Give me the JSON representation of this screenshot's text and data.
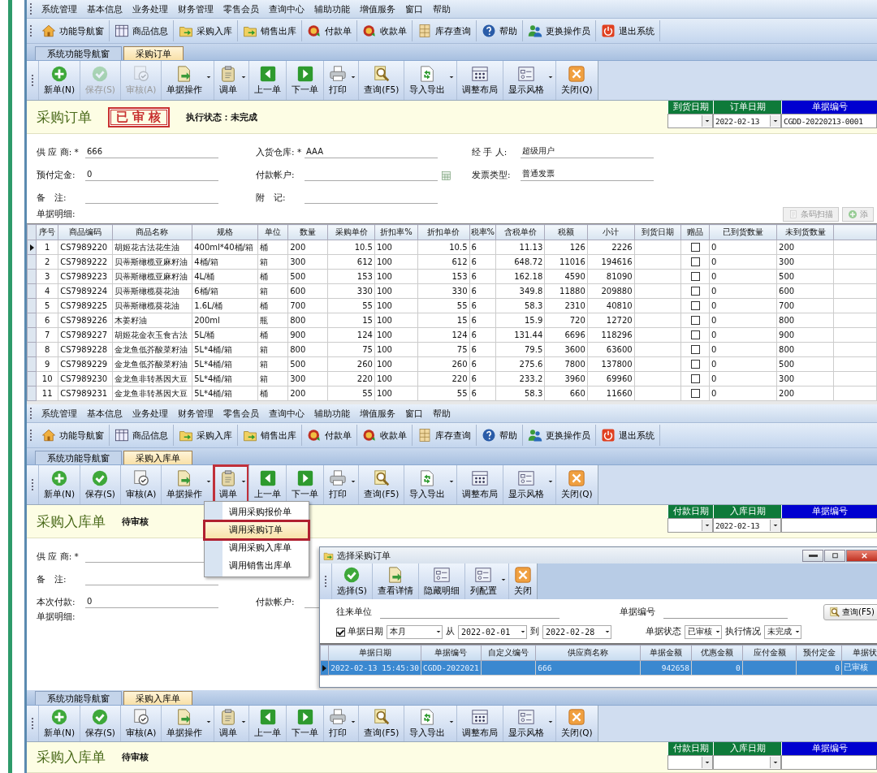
{
  "screens": [
    {
      "menu": [
        "系统管理",
        "基本信息",
        "业务处理",
        "财务管理",
        "零售会员",
        "查询中心",
        "辅助功能",
        "增值服务",
        "窗口",
        "帮助"
      ],
      "quickbar": [
        {
          "label": "功能导航窗",
          "kind": "home"
        },
        {
          "label": "商品信息",
          "kind": "table"
        },
        {
          "label": "采购入库",
          "kind": "folder"
        },
        {
          "label": "销售出库",
          "kind": "folder"
        },
        {
          "label": "付款单",
          "kind": "coin"
        },
        {
          "label": "收款单",
          "kind": "coin"
        },
        {
          "label": "库存查询",
          "kind": "cabinet"
        },
        {
          "label": "帮助",
          "kind": "help"
        },
        {
          "label": "更换操作员",
          "kind": "people"
        },
        {
          "label": "退出系统",
          "kind": "power"
        }
      ],
      "tabs": [
        {
          "label": "系统功能导航窗",
          "selected": false
        },
        {
          "label": "采购订单",
          "selected": true
        }
      ],
      "toolbar": [
        {
          "label": "新单(N)",
          "kind": "add",
          "disabled": false,
          "dropdown": false,
          "annotated": false
        },
        {
          "label": "保存(S)",
          "kind": "check",
          "disabled": true,
          "dropdown": false,
          "annotated": false
        },
        {
          "label": "审核(A)",
          "kind": "audit",
          "disabled": true,
          "dropdown": false,
          "annotated": false
        },
        {
          "label": "单据操作",
          "kind": "docarrow",
          "disabled": false,
          "dropdown": true,
          "annotated": false
        },
        {
          "label": "调单",
          "kind": "clipboard",
          "disabled": false,
          "dropdown": true,
          "annotated": false
        },
        {
          "label": "上一单",
          "kind": "prev",
          "disabled": false,
          "dropdown": false,
          "annotated": false
        },
        {
          "label": "下一单",
          "kind": "next",
          "disabled": false,
          "dropdown": false,
          "annotated": false
        },
        {
          "label": "打印",
          "kind": "printer",
          "disabled": false,
          "dropdown": true,
          "annotated": false
        },
        {
          "label": "查询(F5)",
          "kind": "search",
          "disabled": false,
          "dropdown": false,
          "annotated": false
        },
        {
          "label": "导入导出",
          "kind": "import",
          "disabled": false,
          "dropdown": true,
          "annotated": false
        },
        {
          "label": "调整布局",
          "kind": "grid",
          "disabled": false,
          "dropdown": false,
          "annotated": false
        },
        {
          "label": "显示风格",
          "kind": "layout",
          "disabled": false,
          "dropdown": true,
          "annotated": false
        },
        {
          "label": "关闭(Q)",
          "kind": "close",
          "disabled": false,
          "dropdown": false,
          "annotated": false
        }
      ],
      "header": {
        "title": "采购订单",
        "stamp": {
          "kind": "seal",
          "text": "已审核"
        },
        "status": "执行状态：未完成",
        "dates": [
          {
            "label": "到货日期",
            "color": "#0e7a3a",
            "dropdown": true
          },
          {
            "label": "订单日期",
            "color": "#0e7a3a",
            "value": "2022-02-13",
            "dropdown": true
          },
          {
            "label": "单据编号",
            "color": "#0000d0",
            "value": "CGDD-20220213-0001",
            "dropdown": false
          }
        ]
      },
      "form": [
        [
          {
            "label": "供 应 商: *",
            "value": "666"
          },
          {
            "label": "入货仓库: *",
            "value": "AAA"
          },
          {
            "label": "经 手 人:",
            "value": "超级用户"
          }
        ],
        [
          {
            "label": "预付定金:",
            "value": "0"
          },
          {
            "label": "付款帐户:",
            "lookup": true
          },
          {
            "label": "发票类型:",
            "value": "普通发票"
          }
        ],
        [
          {
            "label": "备　注:"
          },
          {
            "label": "附　记:"
          }
        ]
      ],
      "detail_label": "单据明细:",
      "detail_buttons": [
        {
          "label": "条码扫描",
          "kind": "doc",
          "disabled": true
        },
        {
          "label": "添",
          "kind": "plus",
          "disabled": true
        }
      ],
      "table": {
        "columns": [
          "序号",
          "商品编码",
          "商品名称",
          "规格",
          "单位",
          "数量",
          "采购单价",
          "折扣率%",
          "折扣单价",
          "税率%",
          "含税单价",
          "税额",
          "小计",
          "到货日期",
          "赠品",
          "已到货数量",
          "未到货数量"
        ],
        "rows": [
          {
            "selected": true,
            "cells": [
              "1",
              "CS7989220",
              "胡姬花古法花生油",
              "400ml*40桶/箱",
              "桶",
              "200",
              "10.5",
              "100",
              "10.5",
              "6",
              "11.13",
              "126",
              "2226",
              null,
              false,
              "0",
              "200"
            ]
          },
          {
            "selected": false,
            "cells": [
              "2",
              "CS7989222",
              "贝蒂斯橄榄亚麻籽油",
              "4桶/箱",
              "箱",
              "300",
              "612",
              "100",
              "612",
              "6",
              "648.72",
              "11016",
              "194616",
              null,
              false,
              "0",
              "300"
            ]
          },
          {
            "selected": false,
            "cells": [
              "3",
              "CS7989223",
              "贝蒂斯橄榄亚麻籽油",
              "4L/桶",
              "桶",
              "500",
              "153",
              "100",
              "153",
              "6",
              "162.18",
              "4590",
              "81090",
              null,
              false,
              "0",
              "500"
            ]
          },
          {
            "selected": false,
            "cells": [
              "4",
              "CS7989224",
              "贝蒂斯橄榄葵花油",
              "6桶/箱",
              "箱",
              "600",
              "330",
              "100",
              "330",
              "6",
              "349.8",
              "11880",
              "209880",
              null,
              false,
              "0",
              "600"
            ]
          },
          {
            "selected": false,
            "cells": [
              "5",
              "CS7989225",
              "贝蒂斯橄榄葵花油",
              "1.6L/桶",
              "桶",
              "700",
              "55",
              "100",
              "55",
              "6",
              "58.3",
              "2310",
              "40810",
              null,
              false,
              "0",
              "700"
            ]
          },
          {
            "selected": false,
            "cells": [
              "6",
              "CS7989226",
              "木姜籽油",
              "200ml",
              "瓶",
              "800",
              "15",
              "100",
              "15",
              "6",
              "15.9",
              "720",
              "12720",
              null,
              false,
              "0",
              "800"
            ]
          },
          {
            "selected": false,
            "cells": [
              "7",
              "CS7989227",
              "胡姬花金衣玉食古法",
              "5L/桶",
              "桶",
              "900",
              "124",
              "100",
              "124",
              "6",
              "131.44",
              "6696",
              "118296",
              null,
              false,
              "0",
              "900"
            ]
          },
          {
            "selected": false,
            "cells": [
              "8",
              "CS7989228",
              "金龙鱼低芥酸菜籽油",
              "5L*4桶/箱",
              "箱",
              "800",
              "75",
              "100",
              "75",
              "6",
              "79.5",
              "3600",
              "63600",
              null,
              false,
              "0",
              "800"
            ]
          },
          {
            "selected": false,
            "cells": [
              "9",
              "CS7989229",
              "金龙鱼低芥酸菜籽油",
              "5L*4桶/箱",
              "箱",
              "500",
              "260",
              "100",
              "260",
              "6",
              "275.6",
              "7800",
              "137800",
              null,
              false,
              "0",
              "500"
            ]
          },
          {
            "selected": false,
            "cells": [
              "10",
              "CS7989230",
              "金龙鱼非转基因大豆",
              "5L*4桶/箱",
              "箱",
              "300",
              "220",
              "100",
              "220",
              "6",
              "233.2",
              "3960",
              "69960",
              null,
              false,
              "0",
              "300"
            ]
          },
          {
            "selected": false,
            "cells": [
              "11",
              "CS7989231",
              "金龙鱼非转基因大豆",
              "5L*4桶/箱",
              "桶",
              "200",
              "55",
              "100",
              "55",
              "6",
              "58.3",
              "660",
              "11660",
              null,
              false,
              "0",
              "200"
            ]
          }
        ]
      }
    },
    {
      "menu": [
        "系统管理",
        "基本信息",
        "业务处理",
        "财务管理",
        "零售会员",
        "查询中心",
        "辅助功能",
        "增值服务",
        "窗口",
        "帮助"
      ],
      "quickbar": [
        {
          "label": "功能导航窗",
          "kind": "home"
        },
        {
          "label": "商品信息",
          "kind": "table"
        },
        {
          "label": "采购入库",
          "kind": "folder"
        },
        {
          "label": "销售出库",
          "kind": "folder"
        },
        {
          "label": "付款单",
          "kind": "coin"
        },
        {
          "label": "收款单",
          "kind": "coin"
        },
        {
          "label": "库存查询",
          "kind": "cabinet"
        },
        {
          "label": "帮助",
          "kind": "help"
        },
        {
          "label": "更换操作员",
          "kind": "people"
        },
        {
          "label": "退出系统",
          "kind": "power"
        }
      ],
      "tabs": [
        {
          "label": "系统功能导航窗",
          "selected": false
        },
        {
          "label": "采购入库单",
          "selected": true
        }
      ],
      "toolbar": [
        {
          "label": "新单(N)",
          "kind": "add",
          "disabled": false,
          "dropdown": false,
          "annotated": false
        },
        {
          "label": "保存(S)",
          "kind": "check",
          "disabled": false,
          "dropdown": false,
          "annotated": false
        },
        {
          "label": "审核(A)",
          "kind": "audit",
          "disabled": false,
          "dropdown": false,
          "annotated": false
        },
        {
          "label": "单据操作",
          "kind": "docarrow",
          "disabled": false,
          "dropdown": true,
          "annotated": false
        },
        {
          "label": "调单",
          "kind": "clipboard",
          "disabled": false,
          "dropdown": true,
          "annotated": true
        },
        {
          "label": "上一单",
          "kind": "prev",
          "disabled": false,
          "dropdown": false,
          "annotated": false
        },
        {
          "label": "下一单",
          "kind": "next",
          "disabled": false,
          "dropdown": false,
          "annotated": false
        },
        {
          "label": "打印",
          "kind": "printer",
          "disabled": false,
          "dropdown": true,
          "annotated": false
        },
        {
          "label": "查询(F5)",
          "kind": "search",
          "disabled": false,
          "dropdown": false,
          "annotated": false
        },
        {
          "label": "导入导出",
          "kind": "import",
          "disabled": false,
          "dropdown": true,
          "annotated": false
        },
        {
          "label": "调整布局",
          "kind": "grid",
          "disabled": false,
          "dropdown": false,
          "annotated": false
        },
        {
          "label": "显示风格",
          "kind": "layout",
          "disabled": false,
          "dropdown": true,
          "annotated": false
        },
        {
          "label": "关闭(Q)",
          "kind": "close",
          "disabled": false,
          "dropdown": false,
          "annotated": false
        }
      ],
      "header": {
        "title": "采购入库单",
        "stamp": {
          "kind": "plain",
          "text": "待审核"
        },
        "dates": [
          {
            "label": "付款日期",
            "color": "#0e7a3a",
            "dropdown": true
          },
          {
            "label": "入库日期",
            "color": "#0e7a3a",
            "value": "2022-02-13",
            "dropdown": true
          },
          {
            "label": "单据编号",
            "color": "#0000d0",
            "dropdown": false
          }
        ]
      },
      "form": [
        [
          {
            "label": "供 应 商: *"
          }
        ],
        [
          {
            "label": "备　注:"
          }
        ],
        [
          {
            "label": "本次付款:",
            "value": "0"
          },
          {
            "label": "付款帐户:"
          }
        ]
      ],
      "detail_label": "单据明细:",
      "dropdown_menu": [
        {
          "label": "调用采购报价单",
          "selected": false,
          "annotated": false
        },
        {
          "label": "调用采购订单",
          "selected": true,
          "annotated": true
        },
        {
          "label": "调用采购入库单",
          "selected": false,
          "annotated": false
        },
        {
          "label": "调用销售出库单",
          "selected": false,
          "annotated": false
        }
      ],
      "dialog": {
        "title": "选择采购订单",
        "toolbar": [
          {
            "label": "选择(S)",
            "kind": "check",
            "dropdown": false
          },
          {
            "label": "查看详情",
            "kind": "docarrow",
            "dropdown": false
          },
          {
            "label": "隐藏明细",
            "kind": "layout",
            "dropdown": false
          },
          {
            "label": "列配置",
            "kind": "layout",
            "dropdown": true
          },
          {
            "label": "关闭",
            "kind": "close",
            "dropdown": false
          }
        ],
        "filters": {
          "partner_label": "往来单位",
          "number_label": "单据编号",
          "query_button": "查询(F5)",
          "date_check": {
            "label": "单据日期",
            "checked": true
          },
          "period": "本月",
          "from_label": "从",
          "from": "2022-02-01",
          "to_label": "到",
          "to": "2022-02-28",
          "status_label": "单据状态",
          "status": "已审核",
          "exec_label": "执行情况",
          "exec": "未完成"
        },
        "columns": [
          "单据日期",
          "单据编号",
          "自定义编号",
          "供应商名称",
          "单据金额",
          "优惠金额",
          "应付金额",
          "预付定金",
          "单据状"
        ],
        "rows": [
          {
            "selected": true,
            "cells": [
              "2022-02-13 15:45:30",
              "CGDD-2022021",
              null,
              "666",
              "942658",
              "0",
              null,
              "0",
              "已审核"
            ]
          }
        ]
      }
    },
    {
      "tabs": [
        {
          "label": "系统功能导航窗",
          "selected": false
        },
        {
          "label": "采购入库单",
          "selected": true
        }
      ],
      "toolbar": [
        {
          "label": "新单(N)",
          "kind": "add",
          "disabled": false,
          "dropdown": false,
          "annotated": false
        },
        {
          "label": "保存(S)",
          "kind": "check",
          "disabled": false,
          "dropdown": false,
          "annotated": false
        },
        {
          "label": "审核(A)",
          "kind": "audit",
          "disabled": false,
          "dropdown": false,
          "annotated": false
        },
        {
          "label": "单据操作",
          "kind": "docarrow",
          "disabled": false,
          "dropdown": true,
          "annotated": false
        },
        {
          "label": "调单",
          "kind": "clipboard",
          "disabled": false,
          "dropdown": true,
          "annotated": false
        },
        {
          "label": "上一单",
          "kind": "prev",
          "disabled": false,
          "dropdown": false,
          "annotated": false
        },
        {
          "label": "下一单",
          "kind": "next",
          "disabled": false,
          "dropdown": false,
          "annotated": false
        },
        {
          "label": "打印",
          "kind": "printer",
          "disabled": false,
          "dropdown": true,
          "annotated": false
        },
        {
          "label": "查询(F5)",
          "kind": "search",
          "disabled": false,
          "dropdown": false,
          "annotated": false
        },
        {
          "label": "导入导出",
          "kind": "import",
          "disabled": false,
          "dropdown": true,
          "annotated": false
        },
        {
          "label": "调整布局",
          "kind": "grid",
          "disabled": false,
          "dropdown": false,
          "annotated": false
        },
        {
          "label": "显示风格",
          "kind": "layout",
          "disabled": false,
          "dropdown": true,
          "annotated": false
        },
        {
          "label": "关闭(Q)",
          "kind": "close",
          "disabled": false,
          "dropdown": false,
          "annotated": false
        }
      ],
      "header": {
        "title": "采购入库单",
        "stamp": {
          "kind": "plain",
          "text": "待审核"
        },
        "dates": [
          {
            "label": "付款日期",
            "color": "#0e7a3a",
            "dropdown": true
          },
          {
            "label": "入库日期",
            "color": "#0e7a3a",
            "dropdown": true
          },
          {
            "label": "单据编号",
            "color": "#0000d0",
            "dropdown": false
          }
        ]
      }
    }
  ]
}
